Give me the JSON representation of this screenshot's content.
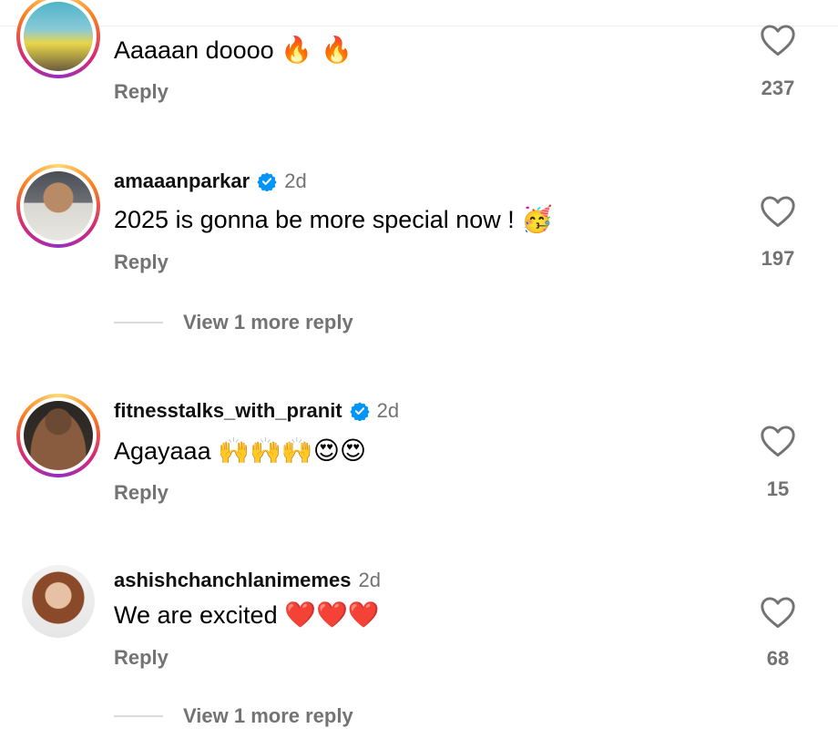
{
  "comments": [
    {
      "username": "",
      "time": "",
      "text": "Aaaaan doooo",
      "emojis": "🔥 🔥",
      "reply_label": "Reply",
      "likes": "237",
      "verified": false,
      "avatar": "cartoon-avatar"
    },
    {
      "username": "amaaanparkar",
      "time": "2d",
      "text": "2025 is gonna be more special now !",
      "emojis": "🥳",
      "reply_label": "Reply",
      "likes": "197",
      "verified": true,
      "avatar": "man-avatar",
      "view_more": "View 1 more reply"
    },
    {
      "username": "fitnesstalks_with_pranit",
      "time": "2d",
      "text": "Agayaaa",
      "emojis": "🙌🙌🙌😍😍",
      "reply_label": "Reply",
      "likes": "15",
      "verified": true,
      "avatar": "fitness-avatar"
    },
    {
      "username": "ashishchanchlanimemes",
      "time": "2d",
      "text": "We are excited",
      "emojis": "❤️❤️❤️",
      "reply_label": "Reply",
      "likes": "68",
      "verified": false,
      "avatar": "curly-hair-avatar",
      "view_more": "View 1 more reply"
    }
  ],
  "colors": {
    "secondary_text": "#737373",
    "verified_blue": "#0095f6",
    "story_ring": "#d62976"
  }
}
